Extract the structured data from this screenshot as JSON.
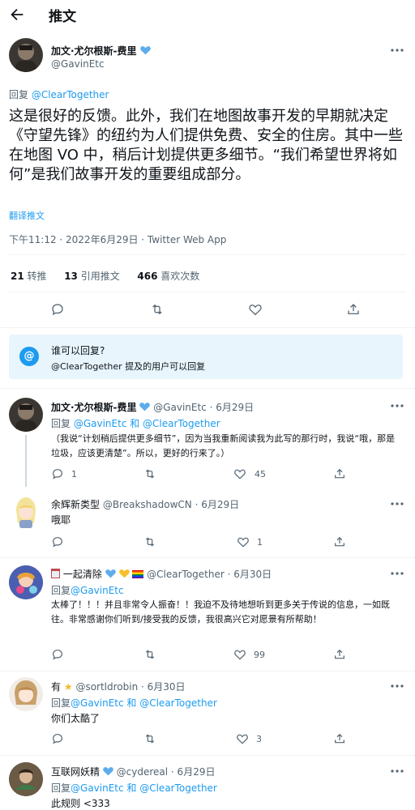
{
  "header": {
    "title": "推文"
  },
  "main_tweet": {
    "author_name": "加文·尤尔根斯-费里",
    "author_handle": "@GavinEtc",
    "reply_prefix": "回复 ",
    "reply_to": "@ClearTogether",
    "body": "这是很好的反馈。此外，我们在地图故事开发的早期就决定《守望先锋》的纽约为人们提供免费、安全的住房。其中一些在地图 VO 中，稍后计划提供更多细节。“我们希望世界将如何”是我们故事开发的重要组成部分。",
    "translate": "翻译推文",
    "meta": "下午11:12 · 2022年6月29日 · Twitter Web App",
    "stats": {
      "retweets_count": "21",
      "retweets_label": "转推",
      "quotes_count": "13",
      "quotes_label": "引用推文",
      "likes_count": "466",
      "likes_label": "喜欢次数"
    }
  },
  "reply_restriction": {
    "title": "谁可以回复?",
    "text": "@ClearTogether 提及的用户可以回复"
  },
  "replies": [
    {
      "name": "加文·尤尔根斯-费里",
      "handle_date": "@GavinEtc · 6月29日",
      "reply_prefix": "回复 ",
      "reply_to": "@GavinEtc 和 @ClearTogether",
      "body": "（我说“计划稍后提供更多细节”，因为当我重新阅读我为此写的那行时，我说“哦，那是垃圾，应该更清楚”。所以，更好的行来了。）",
      "reply_count": "1",
      "retweet_count": "",
      "like_count": "45"
    },
    {
      "name": "余辉新类型",
      "handle_date": "@BreakshadowCN · 6月29日",
      "body": "哦耶",
      "reply_count": "",
      "retweet_count": "",
      "like_count": "1"
    },
    {
      "name": "一起清除",
      "handle_date": "@ClearTogether · 6月30日",
      "reply_prefix": "回复",
      "reply_to": "@GavinEtc",
      "body": "太棒了！！！并且非常令人振奋！！我迫不及待地想听到更多关于传说的信息，一如既往。非常感谢你们听到/接受我的反馈，我很高兴它对愿景有所帮助！",
      "reply_count": "",
      "retweet_count": "",
      "like_count": "99"
    },
    {
      "name": "有",
      "handle_date": "@sortldrobin · 6月30日",
      "reply_prefix": "回复",
      "reply_to": "@GavinEtc 和 @ClearTogether",
      "body": "你们太酷了",
      "reply_count": "",
      "retweet_count": "",
      "like_count": "3"
    },
    {
      "name": "互联网妖精",
      "handle_date": "@cydereal · 6月29日",
      "reply_prefix": "回复",
      "reply_to": "@GavinEtc 和 @ClearTogether",
      "body": "此规则 <333"
    }
  ],
  "colors": {
    "accent": "#1d9bf0",
    "text": "#0f1419",
    "secondary": "#536471",
    "verified": "#1d9bf0"
  }
}
